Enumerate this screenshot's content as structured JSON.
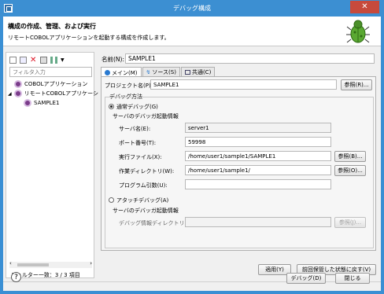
{
  "window": {
    "title": "デバッグ構成",
    "close_glyph": "✕"
  },
  "header": {
    "title": "構成の作成、管理、および実行",
    "subtitle": "リモートCOBOLアプリケーションを起動する構成を作成します。"
  },
  "left": {
    "toolbar_icons": [
      "new-config-icon",
      "duplicate-icon",
      "delete-icon",
      "collapse-icon",
      "filter-icon",
      "dropdown-icon"
    ],
    "filter_placeholder": "フィルタ入力",
    "tree": [
      {
        "label": "COBOLアプリケーション",
        "level": 0,
        "expanded": false
      },
      {
        "label": "リモートCOBOLアプリケーシ",
        "level": 0,
        "expanded": true
      },
      {
        "label": "SAMPLE1",
        "level": 1,
        "selected": true
      }
    ],
    "status": "フィルター一致：3 / 3 項目"
  },
  "config": {
    "name_label": "名前(N):",
    "name_value": "SAMPLE1",
    "tabs": [
      {
        "label": "メイン(M)",
        "active": true
      },
      {
        "label": "ソース(S)",
        "active": false
      },
      {
        "label": "共通(C)",
        "active": false
      }
    ],
    "main": {
      "project_label": "プロジェクト名(P):",
      "project_value": "SAMPLE1",
      "browse_label": "参照(R)...",
      "debug_method_label": "デバッグ方法",
      "normal_debug_label": "通常デバッグ(G)",
      "normal_info_label": "サーバのデバッガ起動情報",
      "server_label": "サーバ名(E):",
      "server_value": "server1",
      "port_label": "ポート番号(T):",
      "port_value": "59998",
      "exec_label": "実行ファイル(X):",
      "exec_value": "/home/user1/sample1/SAMPLE1",
      "exec_browse": "参照(B)...",
      "workdir_label": "作業ディレクトリ(W):",
      "workdir_value": "/home/user1/sample1/",
      "workdir_browse": "参照(O)...",
      "args_label": "プログラム引数(U):",
      "args_value": "",
      "attach_debug_label": "アタッチデバッグ(A)",
      "attach_info_label": "サーバのデバッガ起動情報",
      "debuginfo_label": "デバッグ情報ディレクトリ(F):",
      "debuginfo_value": "",
      "debuginfo_browse": "参照(J)..."
    },
    "apply_label": "適用(Y)",
    "revert_label": "前回保管した状態に戻す(V)"
  },
  "footer": {
    "help_glyph": "?",
    "debug_label": "デバッグ(D)",
    "close_label": "閉じる"
  }
}
